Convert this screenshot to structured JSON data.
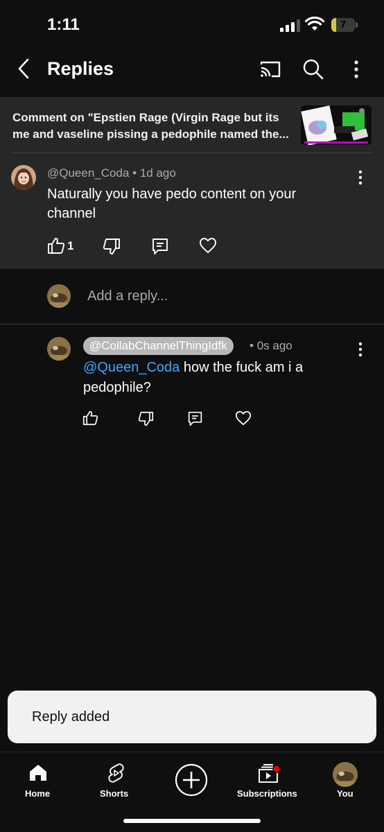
{
  "status_bar": {
    "time": "1:11",
    "battery": "7",
    "battery_fraction": 0.07
  },
  "app_bar": {
    "title": "Replies",
    "back_icon": "chevron-left-icon",
    "cast_icon": "cast-icon",
    "search_icon": "search-icon",
    "more_icon": "more-vertical-icon"
  },
  "context": {
    "text": "Comment on \"Epstien Rage (Virgin Rage but its me and vaseline pissing a pedophile named the..."
  },
  "comment": {
    "author": "@Queen_Coda",
    "time": "1d ago",
    "text": "Naturally you have pedo content on your channel",
    "like_count": "1"
  },
  "add_reply": {
    "placeholder": "Add a reply..."
  },
  "reply": {
    "author": "@CollabChannelThingIdfk",
    "time": "0s ago",
    "mention": "@Queen_Coda",
    "text": "how the fuck am i a pedophile?"
  },
  "toast": {
    "text": "Reply added"
  },
  "bottom_nav": {
    "items": [
      {
        "label": "Home",
        "icon": "home-icon"
      },
      {
        "label": "Shorts",
        "icon": "shorts-icon"
      },
      {
        "label": "",
        "icon": "create-plus-icon"
      },
      {
        "label": "Subscriptions",
        "icon": "subscriptions-icon"
      },
      {
        "label": "You",
        "icon": "avatar"
      }
    ]
  },
  "colors": {
    "background": "#0f0f0f",
    "panel": "#272727",
    "mention": "#3ea6ff",
    "notification_dot": "#ff0000",
    "battery": "#d9c547"
  }
}
